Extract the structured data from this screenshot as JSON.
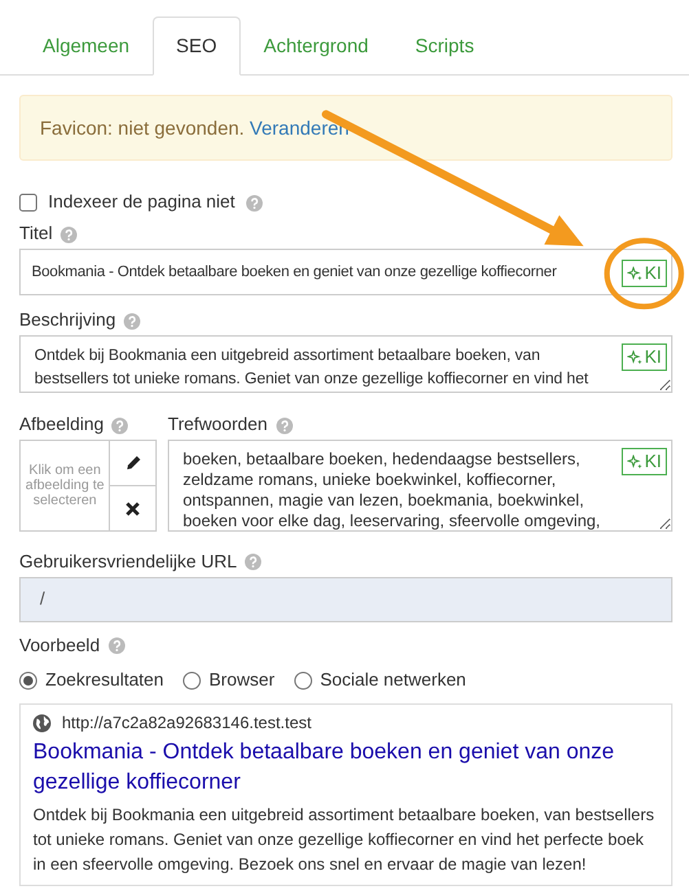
{
  "tabs": [
    {
      "label": "Algemeen",
      "selected": false
    },
    {
      "label": "SEO",
      "selected": true
    },
    {
      "label": "Achtergrond",
      "selected": false
    },
    {
      "label": "Scripts",
      "selected": false
    }
  ],
  "alert": {
    "text": "Favicon: niet gevonden.",
    "link": "Veranderen"
  },
  "noindex": {
    "label": "Indexeer de pagina niet",
    "checked": false
  },
  "title": {
    "label": "Titel",
    "value": "Bookmania - Ontdek betaalbare boeken en geniet van onze gezellige koffiecorner",
    "ai_button": "KI"
  },
  "description": {
    "label": "Beschrijving",
    "value": "Ontdek bij Bookmania een uitgebreid assortiment betaalbare boeken, van bestsellers tot unieke romans. Geniet van onze gezellige koffiecorner en vind het",
    "ai_button": "KI"
  },
  "image": {
    "label": "Afbeelding",
    "placeholder": "Klik om een afbeelding te selecteren"
  },
  "keywords": {
    "label": "Trefwoorden",
    "value": "boeken, betaalbare boeken, hedendaagse bestsellers, zeldzame romans, unieke boekwinkel, koffiecorner, ontspannen, magie van lezen, boekmania, boekwinkel, boeken voor elke dag, leeservaring, sfeervolle omgeving,",
    "ai_button": "KI"
  },
  "url": {
    "label": "Gebruikersvriendelijke URL",
    "value": "/"
  },
  "preview": {
    "label": "Voorbeeld",
    "options": [
      {
        "label": "Zoekresultaten",
        "selected": true
      },
      {
        "label": "Browser",
        "selected": false
      },
      {
        "label": "Sociale netwerken",
        "selected": false
      }
    ],
    "result": {
      "url": "http://a7c2a82a92683146.test.test",
      "title": "Bookmania - Ontdek betaalbare boeken en geniet van onze gezellige koffiecorner",
      "description": "Ontdek bij Bookmania een uitgebreid assortiment betaalbare boeken, van bestsellers tot unieke romans. Geniet van onze gezellige koffiecorner en vind het perfecte boek in een sfeervolle omgeving. Bezoek ons snel en ervaar de magie van lezen!"
    }
  }
}
